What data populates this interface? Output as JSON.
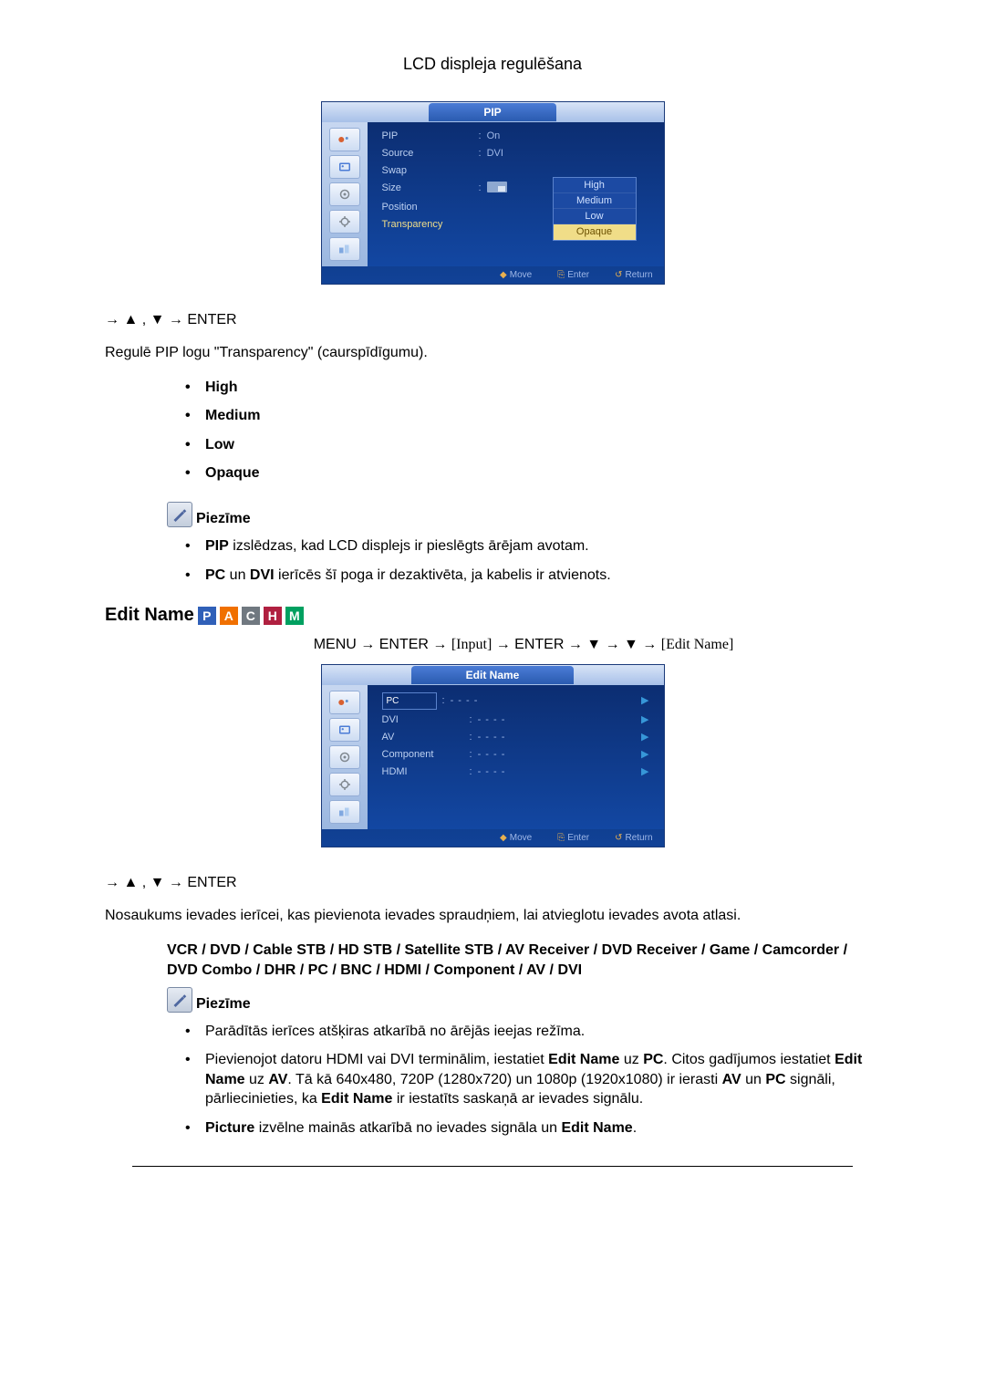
{
  "page_title": "LCD displeja regulēšana",
  "pip_menu": {
    "title": "PIP",
    "rows": [
      {
        "label": "PIP",
        "value": "On"
      },
      {
        "label": "Source",
        "value": "DVI"
      },
      {
        "label": "Swap",
        "value": ""
      },
      {
        "label": "Size",
        "value": ""
      },
      {
        "label": "Position",
        "value": ""
      },
      {
        "label": "Transparency",
        "value": ""
      }
    ],
    "dropdown": [
      "High",
      "Medium",
      "Low",
      "Opaque"
    ],
    "footer": {
      "move": "Move",
      "enter": "Enter",
      "return": "Return"
    }
  },
  "seq1": "→ ▲ , ▼ → ENTER",
  "para_transparency": "Regulē PIP logu \"Transparency\" (caurspīdīgumu).",
  "transparency_options": [
    "High",
    "Medium",
    "Low",
    "Opaque"
  ],
  "note_label": "Piezīme",
  "notes1": [
    {
      "bold": "PIP",
      "rest": " izslēdzas, kad LCD displejs ir pieslēgts ārējam avotam."
    },
    {
      "bold": "PC",
      "mid": " un ",
      "bold2": "DVI",
      "rest": " ierīcēs šī poga ir dezaktivēta, ja kabelis ir atvienots."
    }
  ],
  "edit_name_heading": "Edit Name",
  "badges": [
    "P",
    "A",
    "C",
    "H",
    "M"
  ],
  "menu_path": {
    "p1": "MENU → ENTER → ",
    "b1": "[Input]",
    "p2": " → ENTER → ▼ → ▼ → ",
    "b2": "[Edit Name]"
  },
  "edit_name_menu": {
    "title": "Edit Name",
    "rows": [
      "PC",
      "DVI",
      "AV",
      "Component",
      "HDMI"
    ],
    "footer": {
      "move": "Move",
      "enter": "Enter",
      "return": "Return"
    }
  },
  "seq2": "→ ▲ , ▼ → ENTER",
  "para_edit_name": "Nosaukums ievades ierīcei, kas pievienota ievades spraudņiem, lai atvieglotu ievades avota atlasi.",
  "device_list": "VCR / DVD / Cable STB / HD STB / Satellite STB / AV Receiver / DVD Receiver / Game / Camcorder / DVD Combo / DHR / PC / BNC / HDMI / Component / AV / DVI",
  "notes2": [
    "Parādītās ierīces atšķiras atkarībā no ārējās ieejas režīma.",
    "Pievienojot datoru HDMI vai DVI terminālim, iestatiet Edit Name uz PC. Citos gadījumos iestatiet Edit Name uz AV. Tā kā 640x480, 720P (1280x720) un 1080p (1920x1080) ir ierasti AV un PC signāli, pārliecinieties, ka Edit Name ir iestatīts saskaņā ar ievades signālu.",
    "Picture izvēlne mainās atkarībā no ievades signāla un Edit Name."
  ]
}
